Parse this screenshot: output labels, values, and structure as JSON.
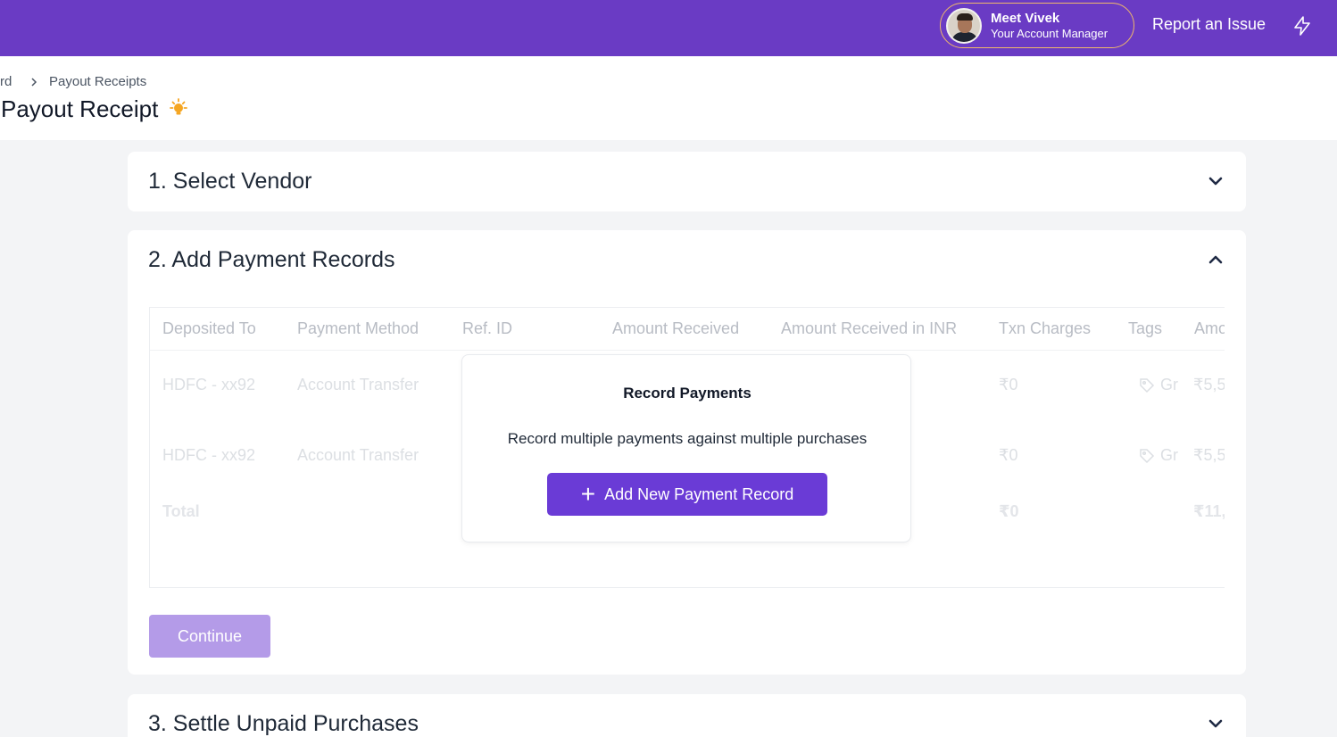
{
  "header": {
    "manager_name": "Meet Vivek",
    "manager_role": "Your Account Manager",
    "report_label": "Report an Issue"
  },
  "breadcrumb": {
    "prev": "rd",
    "current": "Payout Receipts"
  },
  "page_title": "Payout Receipt",
  "sections": {
    "vendor": "1. Select Vendor",
    "payments": "2. Add Payment Records",
    "settle": "3. Settle Unpaid Purchases"
  },
  "table": {
    "headers": [
      "Deposited To",
      "Payment Method",
      "Ref. ID",
      "Amount Received",
      "Amount Received in INR",
      "Txn Charges",
      "Tags",
      "Amo"
    ],
    "rows": [
      {
        "deposited": "HDFC - xx92",
        "method": "Account Transfer",
        "txn": "₹0",
        "tag": "Gr",
        "amount": "₹5,5"
      },
      {
        "deposited": "HDFC - xx92",
        "method": "Account Transfer",
        "txn": "₹0",
        "tag": "Gr",
        "amount": "₹5,5"
      }
    ],
    "total": {
      "label": "Total",
      "txn": "₹0",
      "amount": "₹11,("
    }
  },
  "overlay": {
    "title": "Record Payments",
    "description": "Record multiple payments against multiple purchases",
    "button": "Add New Payment Record"
  },
  "continue_label": "Continue",
  "colors": {
    "brand": "#6a3bc4",
    "button": "#6a3bd6",
    "continue_disabled": "#b49be8",
    "manager_border": "#f0b86a",
    "bulb": "#f5a623"
  }
}
